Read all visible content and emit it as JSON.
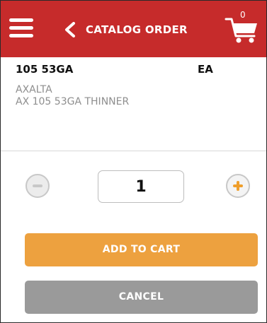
{
  "header": {
    "title": "CATALOG ORDER",
    "cart_count": "0",
    "menu_icon": "hamburger-menu-icon",
    "back_icon": "chevron-left-icon",
    "cart_icon": "shopping-cart-icon"
  },
  "product": {
    "part_number": "105 53GA",
    "unit": "EA",
    "brand": "AXALTA",
    "description": "AX 105 53GA THINNER"
  },
  "quantity": {
    "value": "1",
    "minus_icon": "minus-circle-icon",
    "plus_icon": "plus-circle-icon"
  },
  "actions": {
    "add_to_cart_label": "ADD TO CART",
    "cancel_label": "CANCEL"
  },
  "colors": {
    "header_bg": "#c62b2b",
    "accent_orange": "#eda13f",
    "cancel_gray": "#9a9a9a",
    "muted_text": "#8e8e8e"
  }
}
